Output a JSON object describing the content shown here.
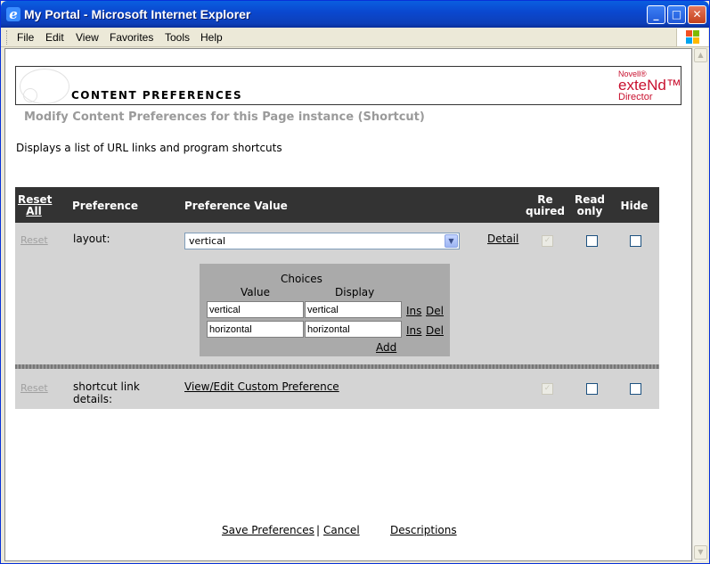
{
  "window": {
    "title": "My Portal - Microsoft Internet Explorer",
    "icon_glyph": "e",
    "minimize_glyph": "_",
    "maximize_glyph": "□",
    "close_glyph": "✕"
  },
  "menu": [
    "File",
    "Edit",
    "View",
    "Favorites",
    "Tools",
    "Help"
  ],
  "header": {
    "title": "CONTENT PREFERENCES",
    "brand_top": "Novell®",
    "brand_main": "exteNd™",
    "brand_sub": "Director"
  },
  "subtitle": "Modify Content Preferences for this Page instance (Shortcut)",
  "description": "Displays a list of URL links and program shortcuts",
  "table": {
    "headers": {
      "reset_all_1": "Reset",
      "reset_all_2": "All",
      "preference": "Preference",
      "value": "Preference Value",
      "required_1": "Re",
      "required_2": "quired",
      "readonly_1": "Read",
      "readonly_2": "only",
      "hide": "Hide"
    },
    "rows": [
      {
        "reset": "Reset",
        "name": "layout:",
        "selected": "vertical",
        "detail": "Detail"
      },
      {
        "reset": "Reset",
        "name_1": "shortcut link",
        "name_2": "details:",
        "custom_link": "View/Edit Custom Preference"
      }
    ],
    "checkbox_mark": "✓"
  },
  "choices": {
    "title": "Choices",
    "col_value": "Value",
    "col_display": "Display",
    "items": [
      {
        "value": "vertical",
        "display": "vertical",
        "ins": "Ins",
        "del": "Del"
      },
      {
        "value": "horizontal",
        "display": "horizontal",
        "ins": "Ins",
        "del": "Del"
      }
    ],
    "add": "Add"
  },
  "footer": {
    "save": "Save Preferences",
    "separator": "|",
    "cancel": "Cancel",
    "descriptions": "Descriptions"
  },
  "scroll": {
    "up": "▲",
    "down": "▼"
  },
  "select_arrow": "▼"
}
